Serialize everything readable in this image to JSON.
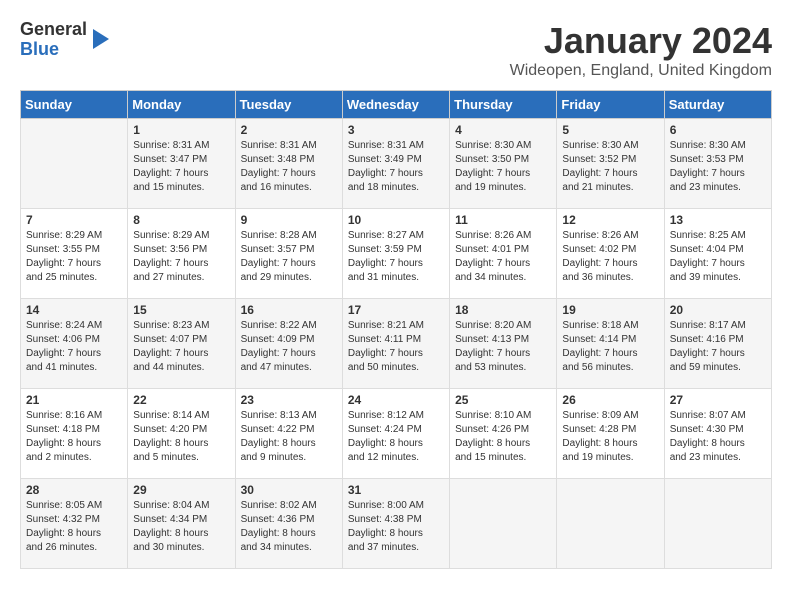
{
  "header": {
    "logo_line1": "General",
    "logo_line2": "Blue",
    "month_title": "January 2024",
    "location": "Wideopen, England, United Kingdom"
  },
  "days_of_week": [
    "Sunday",
    "Monday",
    "Tuesday",
    "Wednesday",
    "Thursday",
    "Friday",
    "Saturday"
  ],
  "weeks": [
    [
      {
        "day": "",
        "info": ""
      },
      {
        "day": "1",
        "info": "Sunrise: 8:31 AM\nSunset: 3:47 PM\nDaylight: 7 hours\nand 15 minutes."
      },
      {
        "day": "2",
        "info": "Sunrise: 8:31 AM\nSunset: 3:48 PM\nDaylight: 7 hours\nand 16 minutes."
      },
      {
        "day": "3",
        "info": "Sunrise: 8:31 AM\nSunset: 3:49 PM\nDaylight: 7 hours\nand 18 minutes."
      },
      {
        "day": "4",
        "info": "Sunrise: 8:30 AM\nSunset: 3:50 PM\nDaylight: 7 hours\nand 19 minutes."
      },
      {
        "day": "5",
        "info": "Sunrise: 8:30 AM\nSunset: 3:52 PM\nDaylight: 7 hours\nand 21 minutes."
      },
      {
        "day": "6",
        "info": "Sunrise: 8:30 AM\nSunset: 3:53 PM\nDaylight: 7 hours\nand 23 minutes."
      }
    ],
    [
      {
        "day": "7",
        "info": "Sunrise: 8:29 AM\nSunset: 3:55 PM\nDaylight: 7 hours\nand 25 minutes."
      },
      {
        "day": "8",
        "info": "Sunrise: 8:29 AM\nSunset: 3:56 PM\nDaylight: 7 hours\nand 27 minutes."
      },
      {
        "day": "9",
        "info": "Sunrise: 8:28 AM\nSunset: 3:57 PM\nDaylight: 7 hours\nand 29 minutes."
      },
      {
        "day": "10",
        "info": "Sunrise: 8:27 AM\nSunset: 3:59 PM\nDaylight: 7 hours\nand 31 minutes."
      },
      {
        "day": "11",
        "info": "Sunrise: 8:26 AM\nSunset: 4:01 PM\nDaylight: 7 hours\nand 34 minutes."
      },
      {
        "day": "12",
        "info": "Sunrise: 8:26 AM\nSunset: 4:02 PM\nDaylight: 7 hours\nand 36 minutes."
      },
      {
        "day": "13",
        "info": "Sunrise: 8:25 AM\nSunset: 4:04 PM\nDaylight: 7 hours\nand 39 minutes."
      }
    ],
    [
      {
        "day": "14",
        "info": "Sunrise: 8:24 AM\nSunset: 4:06 PM\nDaylight: 7 hours\nand 41 minutes."
      },
      {
        "day": "15",
        "info": "Sunrise: 8:23 AM\nSunset: 4:07 PM\nDaylight: 7 hours\nand 44 minutes."
      },
      {
        "day": "16",
        "info": "Sunrise: 8:22 AM\nSunset: 4:09 PM\nDaylight: 7 hours\nand 47 minutes."
      },
      {
        "day": "17",
        "info": "Sunrise: 8:21 AM\nSunset: 4:11 PM\nDaylight: 7 hours\nand 50 minutes."
      },
      {
        "day": "18",
        "info": "Sunrise: 8:20 AM\nSunset: 4:13 PM\nDaylight: 7 hours\nand 53 minutes."
      },
      {
        "day": "19",
        "info": "Sunrise: 8:18 AM\nSunset: 4:14 PM\nDaylight: 7 hours\nand 56 minutes."
      },
      {
        "day": "20",
        "info": "Sunrise: 8:17 AM\nSunset: 4:16 PM\nDaylight: 7 hours\nand 59 minutes."
      }
    ],
    [
      {
        "day": "21",
        "info": "Sunrise: 8:16 AM\nSunset: 4:18 PM\nDaylight: 8 hours\nand 2 minutes."
      },
      {
        "day": "22",
        "info": "Sunrise: 8:14 AM\nSunset: 4:20 PM\nDaylight: 8 hours\nand 5 minutes."
      },
      {
        "day": "23",
        "info": "Sunrise: 8:13 AM\nSunset: 4:22 PM\nDaylight: 8 hours\nand 9 minutes."
      },
      {
        "day": "24",
        "info": "Sunrise: 8:12 AM\nSunset: 4:24 PM\nDaylight: 8 hours\nand 12 minutes."
      },
      {
        "day": "25",
        "info": "Sunrise: 8:10 AM\nSunset: 4:26 PM\nDaylight: 8 hours\nand 15 minutes."
      },
      {
        "day": "26",
        "info": "Sunrise: 8:09 AM\nSunset: 4:28 PM\nDaylight: 8 hours\nand 19 minutes."
      },
      {
        "day": "27",
        "info": "Sunrise: 8:07 AM\nSunset: 4:30 PM\nDaylight: 8 hours\nand 23 minutes."
      }
    ],
    [
      {
        "day": "28",
        "info": "Sunrise: 8:05 AM\nSunset: 4:32 PM\nDaylight: 8 hours\nand 26 minutes."
      },
      {
        "day": "29",
        "info": "Sunrise: 8:04 AM\nSunset: 4:34 PM\nDaylight: 8 hours\nand 30 minutes."
      },
      {
        "day": "30",
        "info": "Sunrise: 8:02 AM\nSunset: 4:36 PM\nDaylight: 8 hours\nand 34 minutes."
      },
      {
        "day": "31",
        "info": "Sunrise: 8:00 AM\nSunset: 4:38 PM\nDaylight: 8 hours\nand 37 minutes."
      },
      {
        "day": "",
        "info": ""
      },
      {
        "day": "",
        "info": ""
      },
      {
        "day": "",
        "info": ""
      }
    ]
  ]
}
